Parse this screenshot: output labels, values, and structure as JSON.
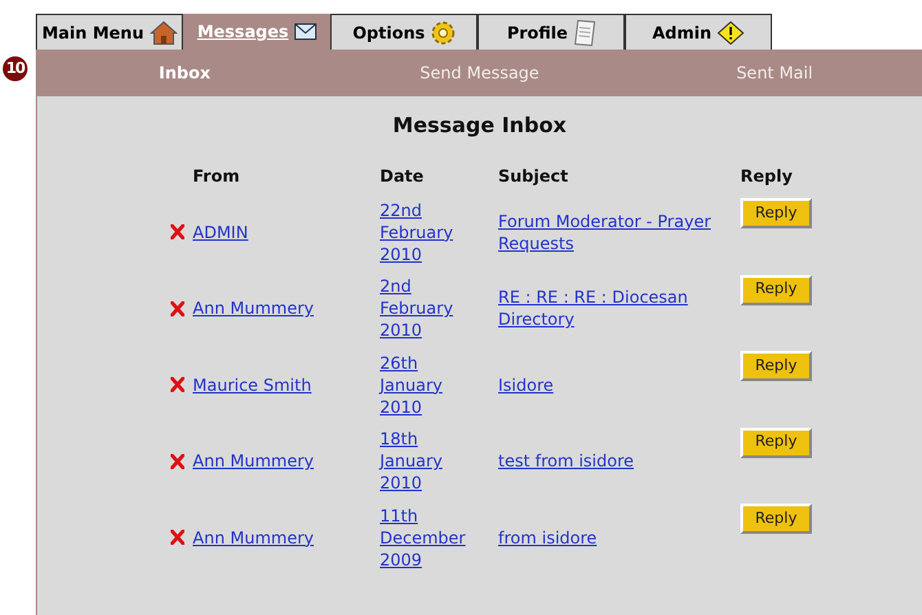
{
  "callout": "10",
  "tabs": [
    {
      "label": "Main Menu",
      "kind": "home",
      "selected": false
    },
    {
      "label": "Messages",
      "kind": "mail",
      "selected": true
    },
    {
      "label": "Options",
      "kind": "settings",
      "selected": false
    },
    {
      "label": "Profile",
      "kind": "profile",
      "selected": false
    },
    {
      "label": "Admin",
      "kind": "admin",
      "selected": false
    }
  ],
  "subnav": [
    {
      "label": "Inbox",
      "selected": true
    },
    {
      "label": "Send Message",
      "selected": false
    },
    {
      "label": "Sent Mail",
      "selected": false
    }
  ],
  "title": "Message Inbox",
  "table": {
    "columns": [
      "From",
      "Date",
      "Subject",
      "Reply"
    ],
    "rows": [
      {
        "from": "ADMIN",
        "date": [
          "22nd",
          "February",
          "2010"
        ],
        "subject": "Forum Moderator - Prayer Requests",
        "reply": "Reply"
      },
      {
        "from": "Ann Mummery",
        "date": [
          "2nd",
          "February",
          "2010"
        ],
        "subject": "RE : RE : RE : Diocesan Directory",
        "reply": "Reply"
      },
      {
        "from": "Maurice Smith",
        "date": [
          "26th",
          "January",
          "2010"
        ],
        "subject": "Isidore",
        "reply": "Reply"
      },
      {
        "from": "Ann Mummery",
        "date": [
          "18th",
          "January",
          "2010"
        ],
        "subject": "test from isidore",
        "reply": "Reply"
      },
      {
        "from": "Ann Mummery",
        "date": [
          "11th",
          "December",
          "2009"
        ],
        "subject": "from isidore",
        "reply": "Reply"
      }
    ]
  }
}
